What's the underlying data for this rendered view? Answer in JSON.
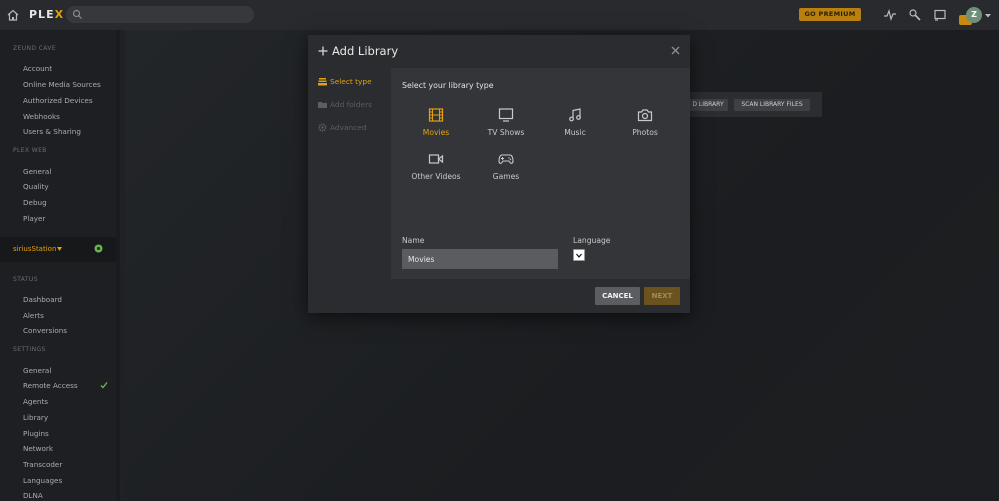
{
  "app": {
    "logo_text": "PLEX",
    "logo_x": "X"
  },
  "topbar": {
    "premium_label": "GO PREMIUM",
    "avatar_initial": "Z",
    "icons": [
      "home-icon",
      "search-icon",
      "activity-icon",
      "settings-wrench-icon",
      "cast-icon"
    ]
  },
  "sidebar": {
    "sections": [
      {
        "title": "ZEUND CAVE",
        "items": [
          "Account",
          "Online Media Sources",
          "Authorized Devices",
          "Webhooks",
          "Users & Sharing"
        ]
      },
      {
        "title": "PLEX WEB",
        "items": [
          "General",
          "Quality",
          "Debug",
          "Player"
        ]
      },
      {
        "title": "STATUS",
        "items": [
          "Dashboard",
          "Alerts",
          "Conversions"
        ]
      },
      {
        "title": "SETTINGS",
        "items": [
          "General",
          "Remote Access",
          "Agents",
          "Library",
          "Plugins",
          "Network",
          "Transcoder",
          "Languages",
          "DLNA"
        ]
      }
    ],
    "server_name": "siriusStation"
  },
  "background": {
    "add_library_partial": "D LIBRARY",
    "scan_library_files": "SCAN LIBRARY FILES"
  },
  "modal": {
    "title": "Add Library",
    "steps": [
      {
        "label": "Select type",
        "active": true
      },
      {
        "label": "Add folders",
        "active": false
      },
      {
        "label": "Advanced",
        "active": false
      }
    ],
    "content_title": "Select your library type",
    "types": [
      {
        "label": "Movies",
        "icon": "film-icon",
        "selected": true
      },
      {
        "label": "TV Shows",
        "icon": "tv-icon",
        "selected": false
      },
      {
        "label": "Music",
        "icon": "music-icon",
        "selected": false
      },
      {
        "label": "Photos",
        "icon": "camera-icon",
        "selected": false
      },
      {
        "label": "Other Videos",
        "icon": "video-camera-icon",
        "selected": false
      },
      {
        "label": "Games",
        "icon": "gamepad-icon",
        "selected": false
      }
    ],
    "name_label": "Name",
    "name_value": "Movies",
    "language_label": "Language",
    "cancel_label": "CANCEL",
    "next_label": "NEXT"
  },
  "colors": {
    "accent": "#e5a00d",
    "topbar": "#282a2d",
    "sidebar": "#1e1f22",
    "modal": "#323437",
    "status_green": "#6bb44f"
  }
}
